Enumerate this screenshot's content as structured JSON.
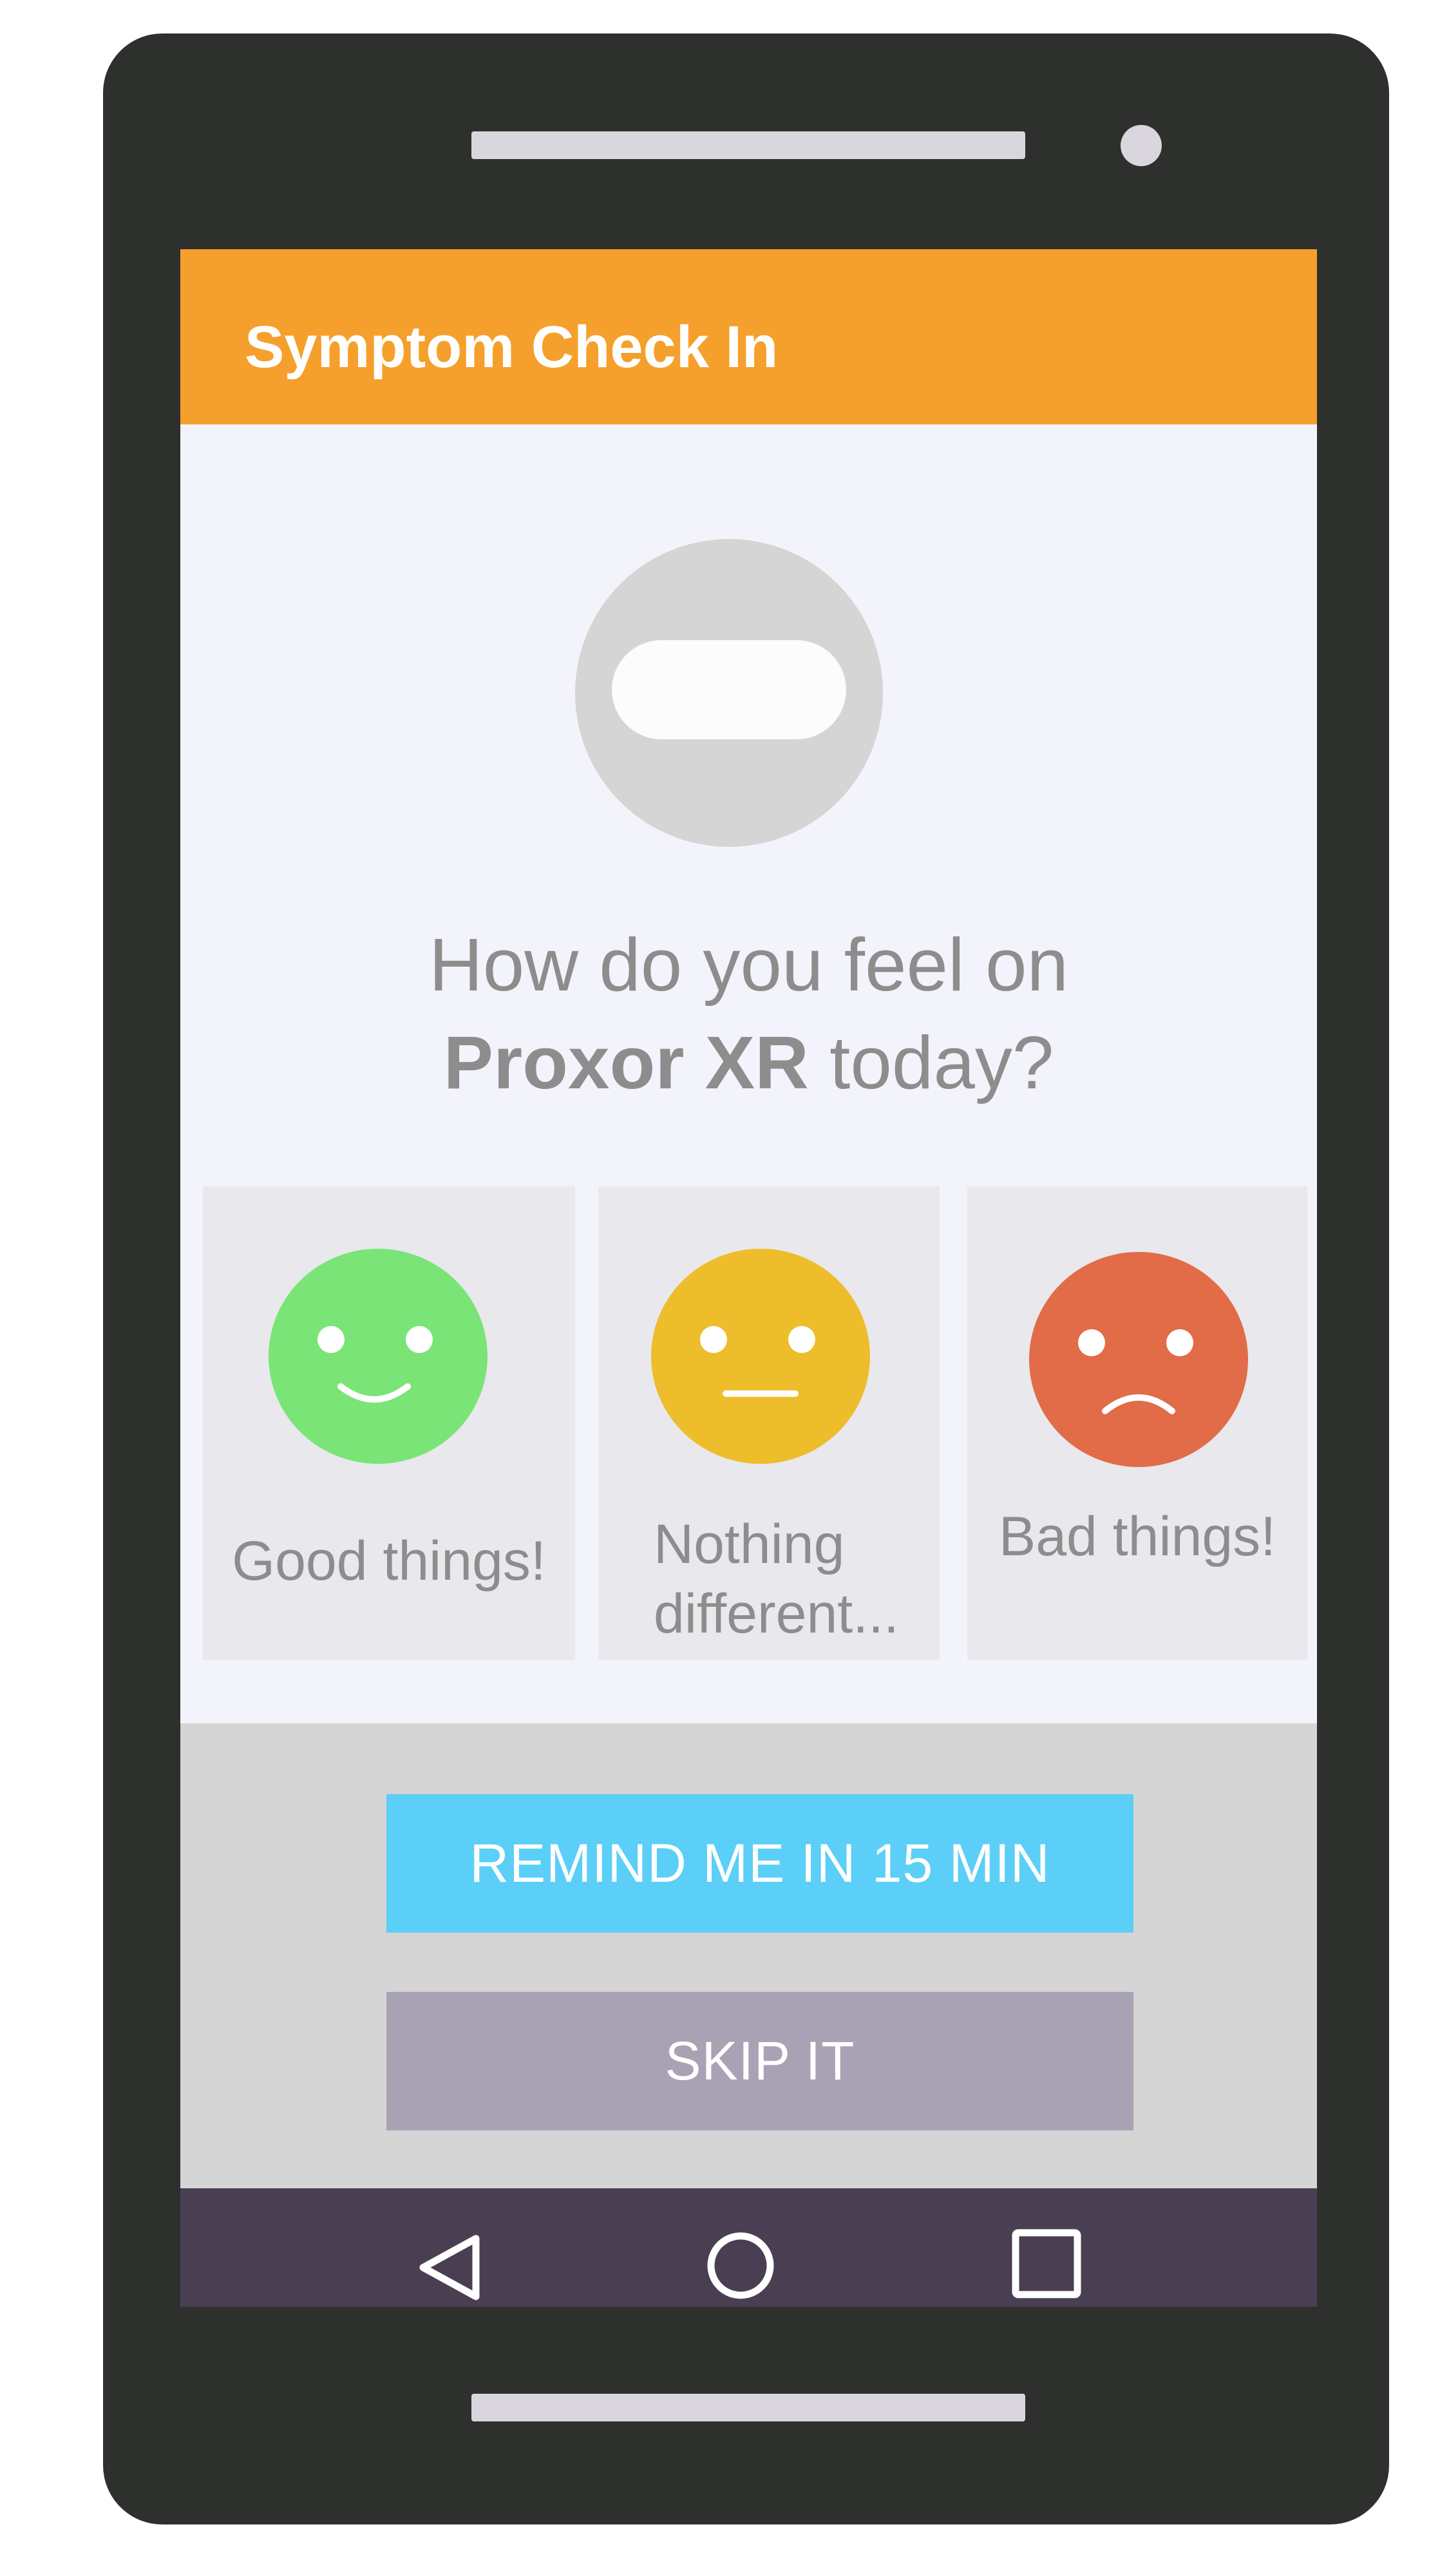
{
  "app_bar": {
    "title": "Symptom Check In",
    "color": "#f5a02c"
  },
  "hero_icon": "pill-icon",
  "question": {
    "line1": "How do you feel on",
    "drug": "Proxor XR",
    "suffix": " today?"
  },
  "options": [
    {
      "label": "Good things!",
      "icon": "smiley-happy-icon",
      "color": "#7ae477"
    },
    {
      "label": "Nothing different...",
      "icon": "smiley-neutral-icon",
      "color": "#edbd2b"
    },
    {
      "label": "Bad things!",
      "icon": "smiley-sad-icon",
      "color": "#e26b48"
    }
  ],
  "buttons": {
    "remind": "REMIND ME IN 15 MIN",
    "skip": "SKIP IT"
  },
  "nav_bar": {
    "items": [
      "back-icon",
      "home-icon",
      "recents-icon"
    ]
  }
}
